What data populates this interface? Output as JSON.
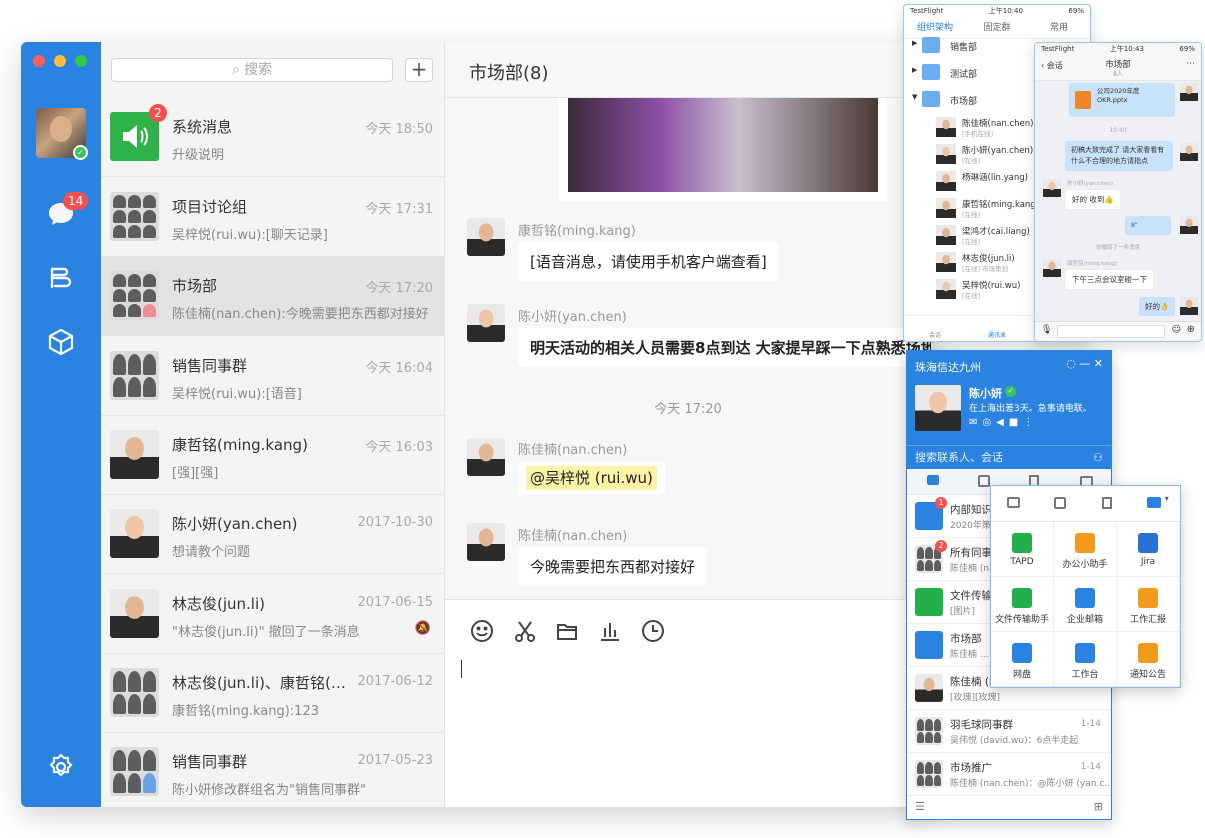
{
  "colors": {
    "accent": "#2a83e0",
    "badge": "#f35050",
    "online": "#3ec25b",
    "mention": "#fcf3a8"
  },
  "sidebar": {
    "chat_badge": "14",
    "icons": [
      "avatar",
      "chat-icon",
      "org-icon",
      "box-icon",
      "settings-icon"
    ]
  },
  "search": {
    "placeholder": "搜索"
  },
  "conversations": [
    {
      "name": "系统消息",
      "time": "今天 18:50",
      "msg": "升级说明",
      "badge": "2"
    },
    {
      "name": "项目讨论组",
      "time": "今天 17:31",
      "msg": "吴梓悦(rui.wu):[聊天记录]"
    },
    {
      "name": "市场部",
      "time": "今天 17:20",
      "msg": "陈佳楠(nan.chen):今晚需要把东西都对接好"
    },
    {
      "name": "销售同事群",
      "time": "今天 16:04",
      "msg": "吴梓悦(rui.wu):[语音]"
    },
    {
      "name": "康哲铭(ming.kang)",
      "time": "今天 16:03",
      "msg": "[强][强]"
    },
    {
      "name": "陈小妍(yan.chen)",
      "time": "2017-10-30",
      "msg": "想请教个问题"
    },
    {
      "name": "林志俊(jun.li)",
      "time": "2017-06-15",
      "msg": "\"林志俊(jun.li)\" 撤回了一条消息"
    },
    {
      "name": "林志俊(jun.li)、康哲铭(m...",
      "time": "2017-06-12",
      "msg": "康哲铭(ming.kang):123"
    },
    {
      "name": "销售同事群",
      "time": "2017-05-23",
      "msg": "陈小妍修改群组名为\"销售同事群\""
    }
  ],
  "chat": {
    "title": "市场部(8)",
    "time_separator": "今天 17:20",
    "messages": [
      {
        "sender": "康哲铭(ming.kang)",
        "text": "[语音消息，请使用手机客户端查看]"
      },
      {
        "sender": "陈小妍(yan.chen)",
        "text": "明天活动的相关人员需要8点到达 大家提早踩一下点熟悉场地"
      },
      {
        "sender": "陈佳楠(nan.chen)",
        "text": "@吴梓悦 (rui.wu)"
      },
      {
        "sender": "陈佳楠(nan.chen)",
        "text": "今晚需要把东西都对接好"
      }
    ]
  },
  "phone1": {
    "status_left": "TestFlight",
    "status_time": "上午10:40",
    "status_batt": "69%",
    "tabs": [
      "组织架构",
      "固定群",
      "常用"
    ],
    "depts": [
      "销售部",
      "测试部",
      "市场部"
    ],
    "members": [
      {
        "name": "陈佳楠(nan.chen)",
        "status": "[手机在线]"
      },
      {
        "name": "陈小妍(yan.chen)",
        "status": "[在线]"
      },
      {
        "name": "杨琳涵(lin.yang)",
        "status": ""
      },
      {
        "name": "康哲铭(ming.kang)",
        "status": "[在线]"
      },
      {
        "name": "梁鸿才(cai.liang)",
        "status": "[在线]"
      },
      {
        "name": "林志俊(jun.li)",
        "status": "[在线] 市场策划"
      },
      {
        "name": "吴梓悦(rui.wu)",
        "status": "[在线]"
      }
    ],
    "bottom": [
      "会话",
      "通讯录",
      "工作"
    ]
  },
  "phone2": {
    "status_left": "TestFlight",
    "status_time": "上午10:43",
    "status_batt": "69%",
    "back": "会话",
    "title": "市场部",
    "subtitle": "8人",
    "file_name": "公司2020年度OKR.pptx",
    "time1": "10:40",
    "msg1": "初稿大致完成了 请大家看看有什么不合理的地方请指点",
    "sender2": "陈小妍(yan.chen)",
    "msg2": "好的 收到👍",
    "voice": "8\"",
    "recall": "你撤回了一条消息",
    "sender3": "康哲铭(ming.kang)",
    "msg3": "下午三点会议室碰一下",
    "msg4": "好的👌"
  },
  "win": {
    "org": "珠海信达九州",
    "name": "陈小妍",
    "status": "在上海出差3天。急事请电联。",
    "search": "搜索联系人、会话",
    "rows": [
      {
        "name": "内部知识库",
        "msg": "2020年策...",
        "time": "",
        "badge": "1"
      },
      {
        "name": "所有同事群",
        "msg": "陈佳楠 (na...",
        "time": "",
        "badge": "2"
      },
      {
        "name": "文件传输助手",
        "msg": "[图片]",
        "time": ""
      },
      {
        "name": "市场部",
        "msg": "陈佳楠 ...",
        "time": ""
      },
      {
        "name": "陈佳楠 (nan.chen)",
        "msg": "[玫瑰][玫瑰]",
        "time": ""
      },
      {
        "name": "羽毛球同事群",
        "msg": "吴伟悦 (david.wu)：6点半走起",
        "time": "1-14"
      },
      {
        "name": "市场推广",
        "msg": "陈佳楠 (nan.chen)：@陈小妍 (yan.c...",
        "time": "1-14"
      }
    ]
  },
  "apps": [
    {
      "label": "TAPD",
      "color": "#23b04a"
    },
    {
      "label": "办公小助手",
      "color": "#f19a1c"
    },
    {
      "label": "Jira",
      "color": "#2a6fd6"
    },
    {
      "label": "文件传输助手",
      "color": "#23b04a"
    },
    {
      "label": "企业邮箱",
      "color": "#2a83e0"
    },
    {
      "label": "工作汇报",
      "color": "#f19a1c"
    },
    {
      "label": "网盘",
      "color": "#2a83e0"
    },
    {
      "label": "工作台",
      "color": "#2a83e0"
    },
    {
      "label": "通知公告",
      "color": "#f19a1c"
    }
  ]
}
